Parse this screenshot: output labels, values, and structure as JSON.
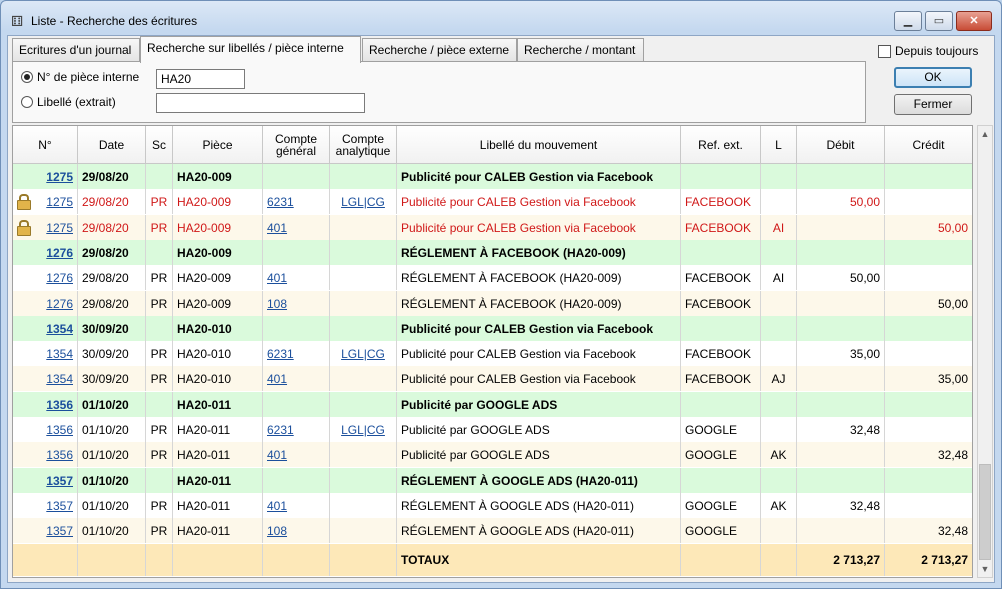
{
  "window": {
    "title": "Liste - Recherche des écritures",
    "icon": "dice-icon",
    "minimize_glyph": "▁",
    "maximize_glyph": "▭",
    "close_glyph": "✕"
  },
  "tabs": [
    {
      "label": "Ecritures d'un journal",
      "active": false
    },
    {
      "label": "Recherche sur libellés / pièce interne",
      "active": true
    },
    {
      "label": "Recherche / pièce externe",
      "active": false
    },
    {
      "label": "Recherche / montant",
      "active": false
    }
  ],
  "search": {
    "piece_label": "N° de pièce interne",
    "piece_value": "HA20",
    "piece_selected": true,
    "libelle_label": "Libellé (extrait)",
    "libelle_value": "",
    "libelle_selected": false
  },
  "options": {
    "depuis_toujours_label": "Depuis toujours",
    "depuis_toujours_checked": false,
    "ok_label": "OK",
    "fermer_label": "Fermer"
  },
  "table": {
    "headers": [
      "N°",
      "Date",
      "Sc",
      "Pièce",
      "Compte général",
      "Compte analytique",
      "Libellé du mouvement",
      "Ref. ext.",
      "L",
      "Débit",
      "Crédit"
    ],
    "rows": [
      {
        "kind": "group",
        "lock": false,
        "red": false,
        "num": "1275",
        "date": "29/08/20",
        "sc": "",
        "piece": "HA20-009",
        "cg": "",
        "ca": "",
        "libelle": "Publicité pour CALEB Gestion via Facebook",
        "ref": "",
        "l": "",
        "debit": "",
        "credit": ""
      },
      {
        "kind": "white",
        "lock": true,
        "red": true,
        "num": "1275",
        "date": "29/08/20",
        "sc": "PR",
        "piece": "HA20-009",
        "cg": "6231",
        "ca": "LGL|CG",
        "libelle": "Publicité pour CALEB Gestion via Facebook",
        "ref": "FACEBOOK",
        "l": "",
        "debit": "50,00",
        "credit": ""
      },
      {
        "kind": "cream",
        "lock": true,
        "red": true,
        "num": "1275",
        "date": "29/08/20",
        "sc": "PR",
        "piece": "HA20-009",
        "cg": "401",
        "ca": "",
        "libelle": "Publicité pour CALEB Gestion via Facebook",
        "ref": "FACEBOOK",
        "l": "AI",
        "debit": "",
        "credit": "50,00"
      },
      {
        "kind": "group",
        "lock": false,
        "red": false,
        "num": "1276",
        "date": "29/08/20",
        "sc": "",
        "piece": "HA20-009",
        "cg": "",
        "ca": "",
        "libelle": "RÉGLEMENT À FACEBOOK (HA20-009)",
        "ref": "",
        "l": "",
        "debit": "",
        "credit": ""
      },
      {
        "kind": "white",
        "lock": false,
        "red": false,
        "num": "1276",
        "date": "29/08/20",
        "sc": "PR",
        "piece": "HA20-009",
        "cg": "401",
        "ca": "",
        "libelle": "RÉGLEMENT À FACEBOOK (HA20-009)",
        "ref": "FACEBOOK",
        "l": "AI",
        "debit": "50,00",
        "credit": ""
      },
      {
        "kind": "cream",
        "lock": false,
        "red": false,
        "num": "1276",
        "date": "29/08/20",
        "sc": "PR",
        "piece": "HA20-009",
        "cg": "108",
        "ca": "",
        "libelle": "RÉGLEMENT À FACEBOOK (HA20-009)",
        "ref": "FACEBOOK",
        "l": "",
        "debit": "",
        "credit": "50,00"
      },
      {
        "kind": "group",
        "lock": false,
        "red": false,
        "num": "1354",
        "date": "30/09/20",
        "sc": "",
        "piece": "HA20-010",
        "cg": "",
        "ca": "",
        "libelle": "Publicité pour CALEB Gestion via Facebook",
        "ref": "",
        "l": "",
        "debit": "",
        "credit": ""
      },
      {
        "kind": "white",
        "lock": false,
        "red": false,
        "num": "1354",
        "date": "30/09/20",
        "sc": "PR",
        "piece": "HA20-010",
        "cg": "6231",
        "ca": "LGL|CG",
        "libelle": "Publicité pour CALEB Gestion via Facebook",
        "ref": "FACEBOOK",
        "l": "",
        "debit": "35,00",
        "credit": ""
      },
      {
        "kind": "cream",
        "lock": false,
        "red": false,
        "num": "1354",
        "date": "30/09/20",
        "sc": "PR",
        "piece": "HA20-010",
        "cg": "401",
        "ca": "",
        "libelle": "Publicité pour CALEB Gestion via Facebook",
        "ref": "FACEBOOK",
        "l": "AJ",
        "debit": "",
        "credit": "35,00"
      },
      {
        "kind": "group",
        "lock": false,
        "red": false,
        "num": "1356",
        "date": "01/10/20",
        "sc": "",
        "piece": "HA20-011",
        "cg": "",
        "ca": "",
        "libelle": "Publicité par GOOGLE ADS",
        "ref": "",
        "l": "",
        "debit": "",
        "credit": ""
      },
      {
        "kind": "white",
        "lock": false,
        "red": false,
        "num": "1356",
        "date": "01/10/20",
        "sc": "PR",
        "piece": "HA20-011",
        "cg": "6231",
        "ca": "LGL|CG",
        "libelle": "Publicité par GOOGLE ADS",
        "ref": "GOOGLE",
        "l": "",
        "debit": "32,48",
        "credit": ""
      },
      {
        "kind": "cream",
        "lock": false,
        "red": false,
        "num": "1356",
        "date": "01/10/20",
        "sc": "PR",
        "piece": "HA20-011",
        "cg": "401",
        "ca": "",
        "libelle": "Publicité par GOOGLE ADS",
        "ref": "GOOGLE",
        "l": "AK",
        "debit": "",
        "credit": "32,48"
      },
      {
        "kind": "group",
        "lock": false,
        "red": false,
        "num": "1357",
        "date": "01/10/20",
        "sc": "",
        "piece": "HA20-011",
        "cg": "",
        "ca": "",
        "libelle": "RÉGLEMENT À GOOGLE ADS (HA20-011)",
        "ref": "",
        "l": "",
        "debit": "",
        "credit": ""
      },
      {
        "kind": "white",
        "lock": false,
        "red": false,
        "num": "1357",
        "date": "01/10/20",
        "sc": "PR",
        "piece": "HA20-011",
        "cg": "401",
        "ca": "",
        "libelle": "RÉGLEMENT À GOOGLE ADS (HA20-011)",
        "ref": "GOOGLE",
        "l": "AK",
        "debit": "32,48",
        "credit": ""
      },
      {
        "kind": "cream",
        "lock": false,
        "red": false,
        "num": "1357",
        "date": "01/10/20",
        "sc": "PR",
        "piece": "HA20-011",
        "cg": "108",
        "ca": "",
        "libelle": "RÉGLEMENT À GOOGLE ADS (HA20-011)",
        "ref": "GOOGLE",
        "l": "",
        "debit": "",
        "credit": "32,48"
      }
    ],
    "totals": {
      "label": "TOTAUX",
      "debit": "2 713,27",
      "credit": "2 713,27"
    }
  },
  "scrollbar": {
    "up_glyph": "▲",
    "down_glyph": "▼"
  },
  "colors": {
    "group_row": "#dafadc",
    "white_row": "#ffffff",
    "cream_row": "#fdf8ea",
    "totals_row": "#fde8b8",
    "locked_text": "#d01818",
    "link": "#1b4f9c"
  }
}
